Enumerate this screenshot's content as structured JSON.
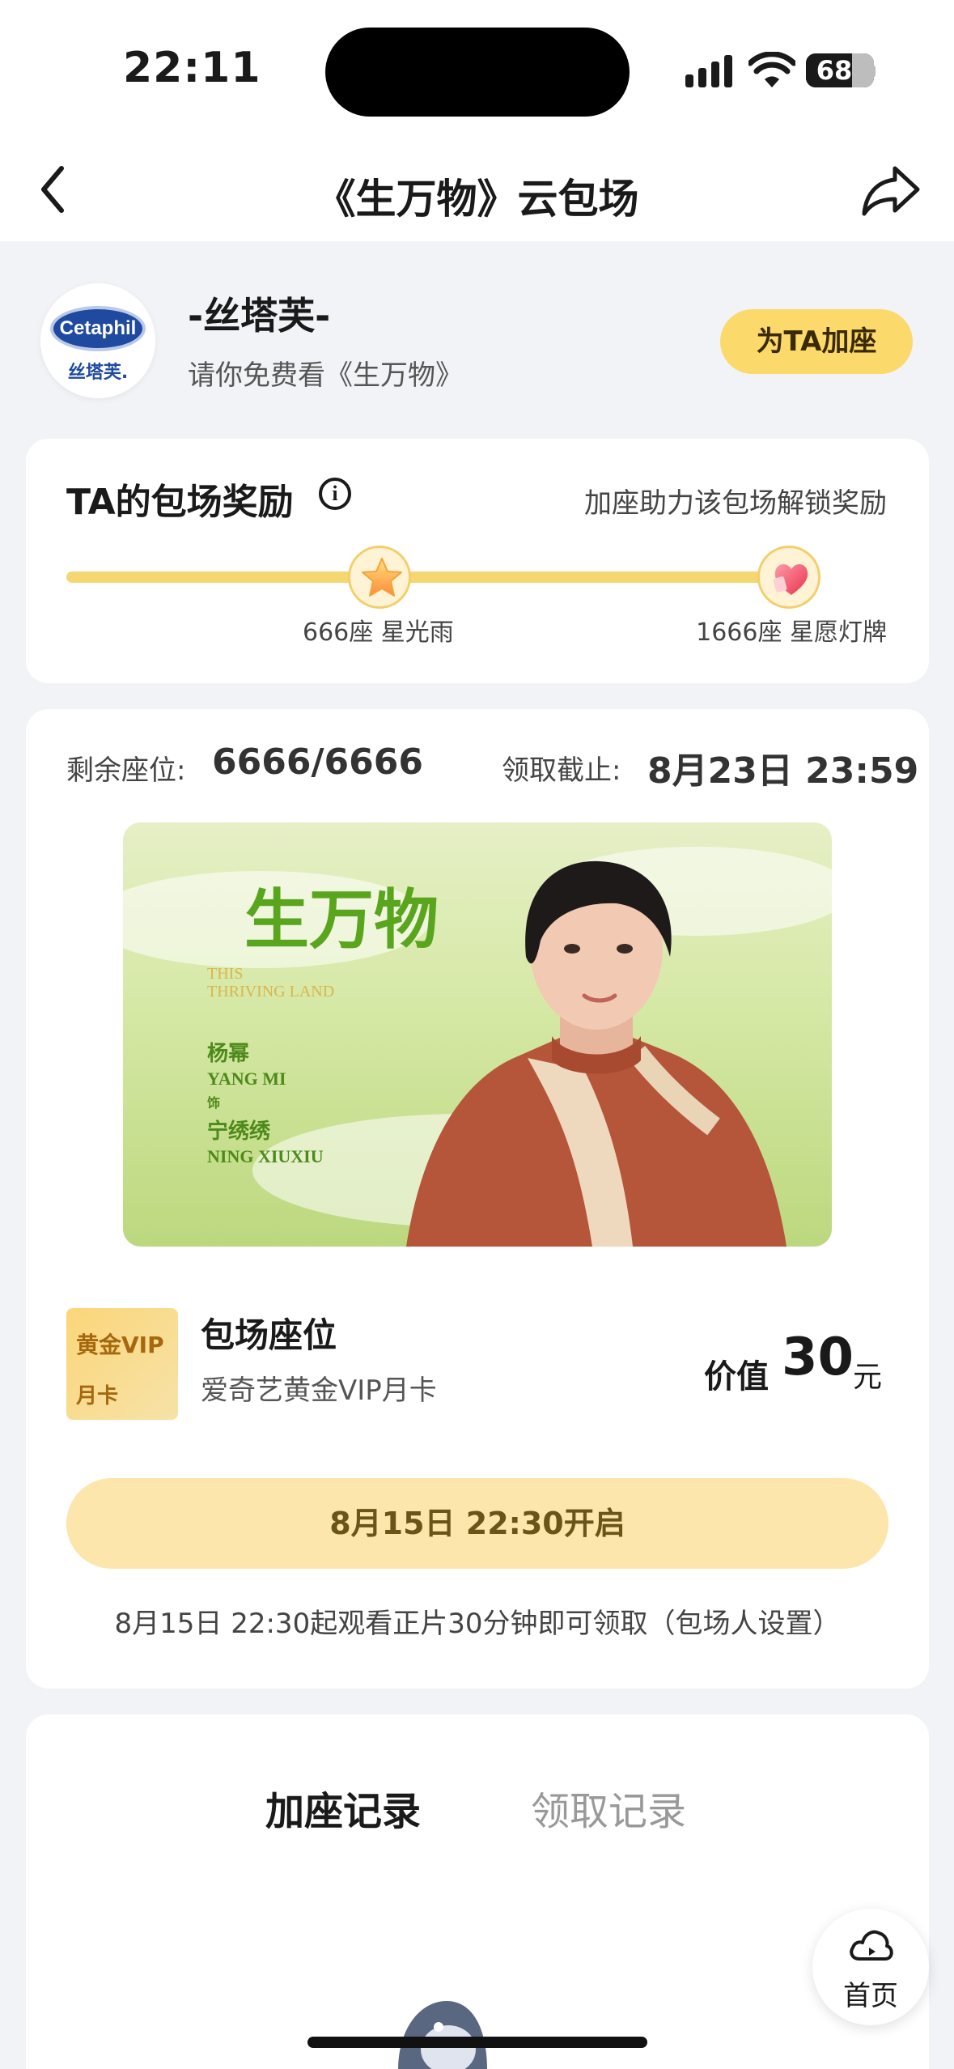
{
  "status_bar": {
    "time": "22:11",
    "battery": "68",
    "battery_level_pct": 68
  },
  "nav": {
    "title": "《生万物》云包场"
  },
  "sponsor": {
    "logo_brand": "Cetaphil",
    "logo_sub": "丝塔芙.",
    "name": "-丝塔芙-",
    "subtitle": "请你免费看《生万物》",
    "add_seat_button": "为TA加座"
  },
  "reward": {
    "title": "TA的包场奖励",
    "hint": "加座助力该包场解锁奖励",
    "progress_pct": 0,
    "milestones": [
      {
        "label": "666座 星光雨",
        "icon": "star-icon"
      },
      {
        "label": "1666座 星愿灯牌",
        "icon": "heart-lightboard-icon"
      }
    ]
  },
  "main": {
    "seats_label": "剩余座位:",
    "seats_value": "6666/6666",
    "deadline_label": "领取截止:",
    "deadline_value": "8月23日 23:59",
    "poster": {
      "logo": "生万物",
      "en_title_1": "THIS",
      "en_title_2": "THRIVING LAND",
      "actor_cn": "杨幂",
      "actor_en": "YANG MI",
      "as": "饰",
      "role_cn": "宁绣绣",
      "role_en": "NING XIUXIU"
    },
    "vip": {
      "card_line1": "黄金VIP",
      "card_line2": "月卡",
      "title": "包场座位",
      "subtitle": "爱奇艺黄金VIP月卡",
      "value_label": "价值",
      "value_num": "30",
      "value_unit": "元"
    },
    "open_button": "8月15日 22:30开启",
    "open_hint": "8月15日 22:30起观看正片30分钟即可领取（包场人设置）"
  },
  "records": {
    "tabs": [
      {
        "label": "加座记录",
        "active": true
      },
      {
        "label": "领取记录",
        "active": false
      }
    ]
  },
  "home_fab": {
    "label": "首页"
  },
  "colors": {
    "accent": "#fbd96b",
    "button_bg": "#fde6ab",
    "progress": "#f7cf4e",
    "page_bg": "#f2f3f7"
  }
}
